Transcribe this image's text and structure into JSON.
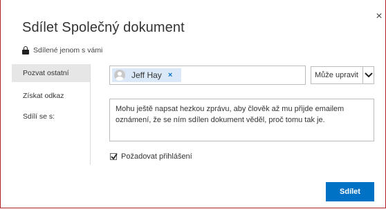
{
  "dialog": {
    "title": "Sdílet Společný dokument",
    "shared_status": "Sdílené jenom s vámi",
    "close_glyph": "×"
  },
  "nav": {
    "items": [
      {
        "label": "Pozvat ostatní",
        "active": true
      },
      {
        "label": "Získat odkaz",
        "active": false
      },
      {
        "label": "Sdílí se s:",
        "active": false
      }
    ]
  },
  "recipients": [
    {
      "name": "Jeff Hay",
      "remove_glyph": "×"
    }
  ],
  "permission": {
    "selected": "Může upravit"
  },
  "message": {
    "value": "Mohu ještě napsat hezkou zprávu, aby člověk až mu přijde emailem oznámení, že se ním sdílen dokument věděl, proč tomu tak je."
  },
  "require_signin": {
    "label": "Požadovat přihlášení",
    "checked": true
  },
  "actions": {
    "share_label": "Sdílet"
  },
  "colors": {
    "accent": "#0072c6",
    "chip_bg": "#dbe8f7",
    "nav_active_bg": "#e6e6e6",
    "border": "#b22222"
  },
  "icons": {
    "close": "close-icon",
    "lock": "lock-icon",
    "avatar": "person-icon",
    "dropdown": "chevron-down-icon",
    "check": "checkmark-icon"
  }
}
